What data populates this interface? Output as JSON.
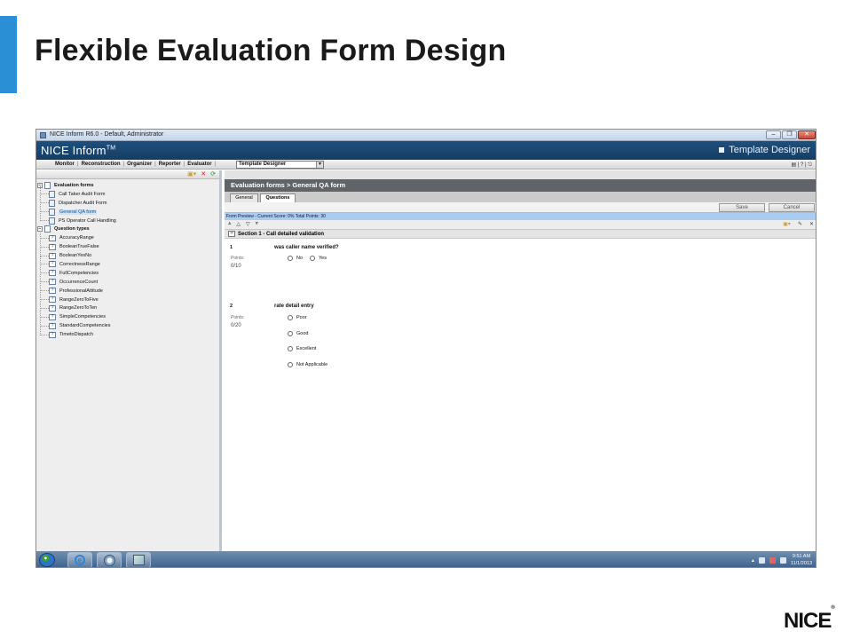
{
  "slide": {
    "title": "Flexible Evaluation Form Design",
    "logo_text": "NICE",
    "logo_mark": "®",
    "accent_color": "#2a8fd4"
  },
  "window": {
    "title": "NICE Inform R6.0 - Default, Administrator",
    "controls": {
      "minimize": "–",
      "maximize": "❐",
      "close": "✕"
    }
  },
  "app": {
    "brand": "NICE Inform",
    "brand_mark": "TM",
    "module_title": "Template Designer",
    "header_color": "#1f4f7d"
  },
  "menu": {
    "items": [
      "Monitor",
      "Reconstruction",
      "Organizer",
      "Reporter",
      "Evaluator"
    ],
    "module_select_value": "Template Designer",
    "right_text": "▤ | ? | ⎋"
  },
  "tree": {
    "root1_label": "Evaluation forms",
    "forms": [
      "Call Taker Audit Form",
      "Dispatcher Audit Form",
      "General QA form",
      "PS Operator Call Handling"
    ],
    "selected_form": "General QA form",
    "root2_label": "Question types",
    "question_types": [
      "AccuracyRange",
      "BooleanTrueFalse",
      "BooleanYesNo",
      "CorrectnessRange",
      "FullCompetencies",
      "OccurrenceCount",
      "ProfessionalAttitude",
      "RangeZeroToFive",
      "RangeZeroToTen",
      "SimpleCompetencies",
      "StandardCompetencies",
      "TimetoDispatch"
    ]
  },
  "editor": {
    "breadcrumb": "Evaluation forms > General QA form",
    "tabs": [
      "General",
      "Questions"
    ],
    "active_tab": "Questions",
    "save_label": "Save",
    "cancel_label": "Cancel",
    "preview_status": "Form Preview - Current Score: 0% Total Points: 30",
    "section_title": "Section 1 - Call detailed validation",
    "questions": [
      {
        "number": "1",
        "text": "was caller name verified?",
        "points_label": "Points:",
        "score": "0/10",
        "options": [
          "No",
          "Yes"
        ]
      },
      {
        "number": "2",
        "text": "rate detail entry",
        "points_label": "Points:",
        "score": "0/20",
        "options": [
          "Poor",
          "Good",
          "Excellent",
          "Not Applicable"
        ]
      }
    ]
  },
  "taskbar": {
    "time": "9:51 AM",
    "date": "11/1/2013",
    "tray_arrow": "▴"
  }
}
